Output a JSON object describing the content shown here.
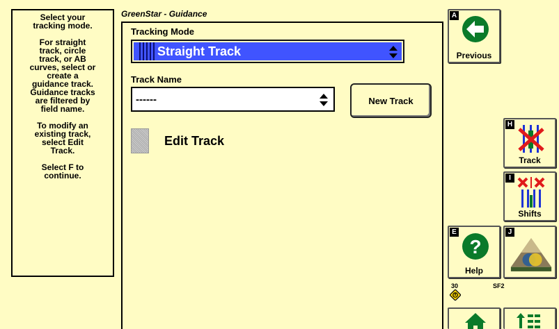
{
  "help_text": [
    "Select your\ntracking mode.",
    "For straight\ntrack, circle\ntrack, or AB\ncurves, select or\ncreate a\nguidance track.\nGuidance tracks\nare filtered by\nfield name.",
    "To modify an\nexisting track,\nselect Edit\nTrack.",
    "Select F to\ncontinue."
  ],
  "title": "GreenStar - Guidance",
  "tracking_mode": {
    "label": "Tracking Mode",
    "value": "Straight Track"
  },
  "track_name": {
    "label": "Track Name",
    "value": "------"
  },
  "new_track_label": "New Track",
  "edit_track_label": "Edit Track",
  "buttons": {
    "previous": {
      "key": "A",
      "label": "Previous"
    },
    "track": {
      "key": "H",
      "label": "Track"
    },
    "shifts": {
      "key": "I",
      "label": "Shifts"
    },
    "help": {
      "key": "E",
      "label": "Help"
    },
    "gs": {
      "key": "J"
    }
  },
  "status": {
    "count": "30",
    "code": "SF2"
  },
  "colors": {
    "background": "#fffcc4",
    "select_blue": "#4054ff",
    "icon_green": "#0a7a2a"
  }
}
